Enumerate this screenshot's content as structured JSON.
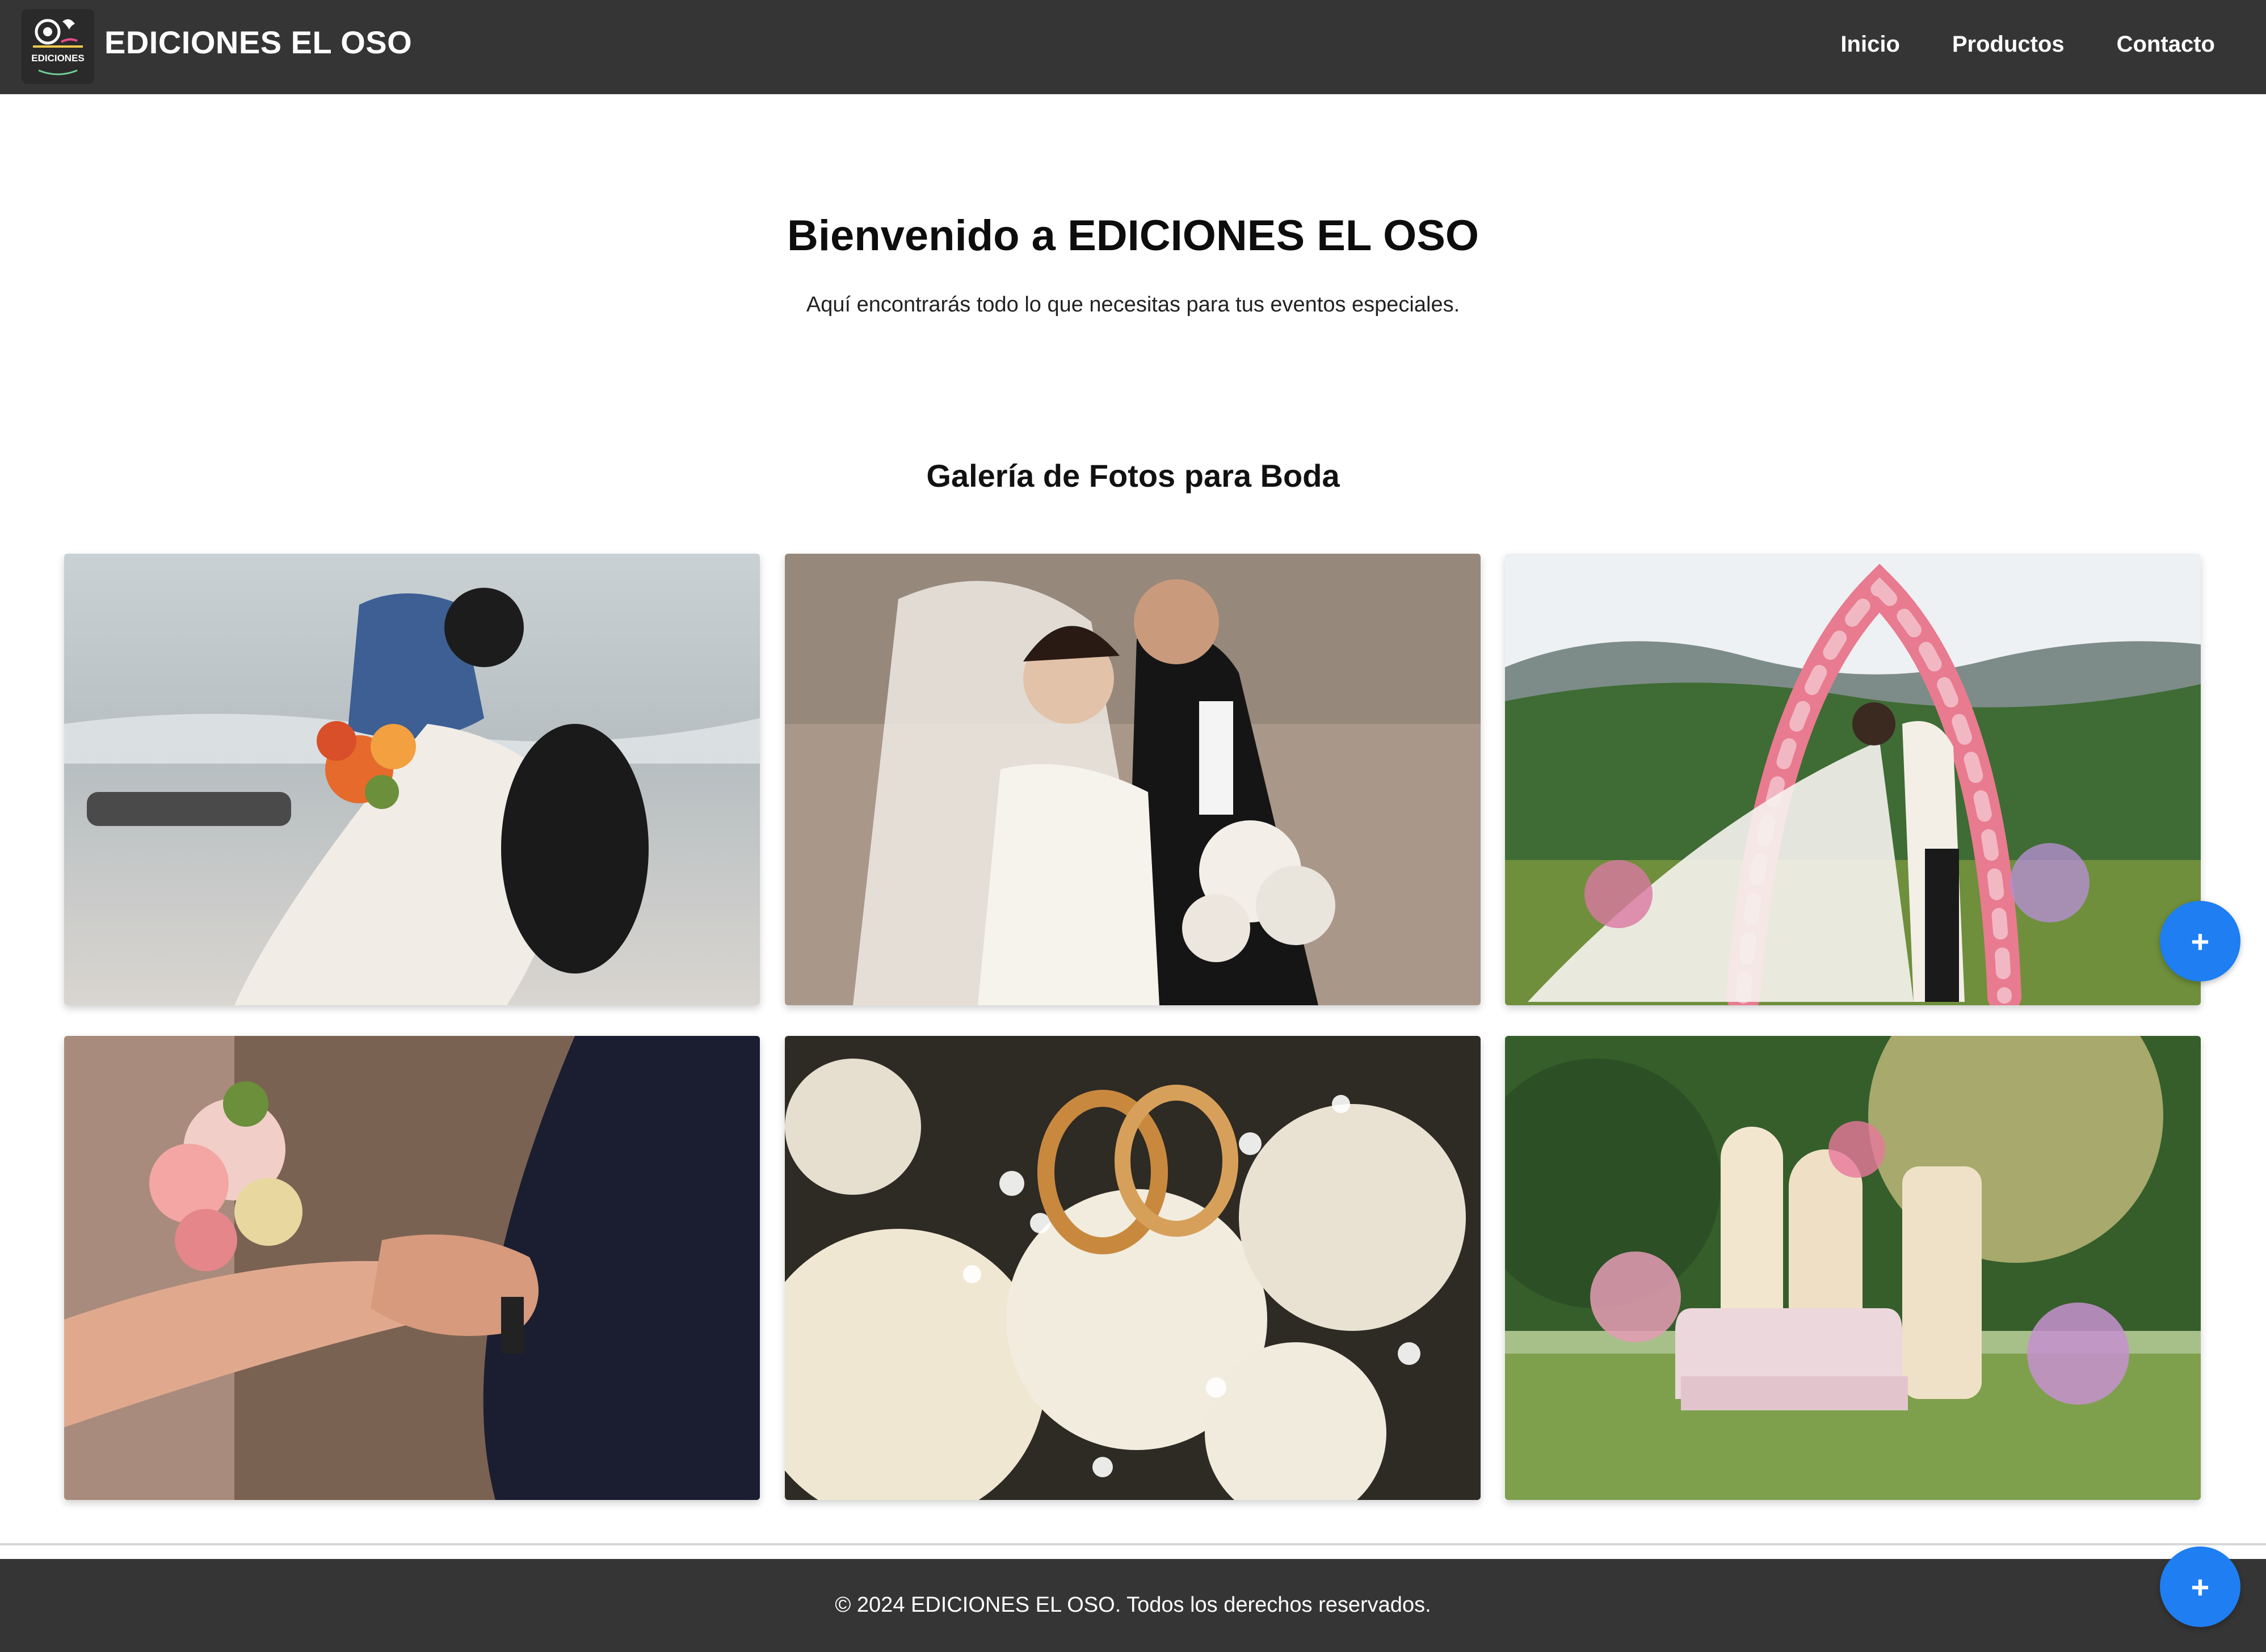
{
  "header": {
    "brand": "EDICIONES EL OSO",
    "logo_text": "EDICIONES",
    "nav": [
      "Inicio",
      "Productos",
      "Contacto"
    ]
  },
  "hero": {
    "title": "Bienvenido a EDICIONES EL OSO",
    "subtitle": "Aquí encontrarás todo lo que necesitas para tus eventos especiales."
  },
  "gallery": {
    "title": "Galería de Fotos para Boda",
    "photos": [
      "beach-kiss-photo",
      "veil-couple-photo",
      "flower-arch-photo",
      "holding-hands-photo",
      "wedding-rings-photo",
      "lounge-setup-photo"
    ]
  },
  "fab": {
    "label": "+",
    "icon": "plus-icon",
    "color": "#1e7ef2"
  },
  "footer": {
    "text": "© 2024 EDICIONES EL OSO. Todos los derechos reservados."
  },
  "colors": {
    "header_bg": "#353535",
    "footer_bg": "#353535",
    "page_bg": "#ffffff"
  }
}
